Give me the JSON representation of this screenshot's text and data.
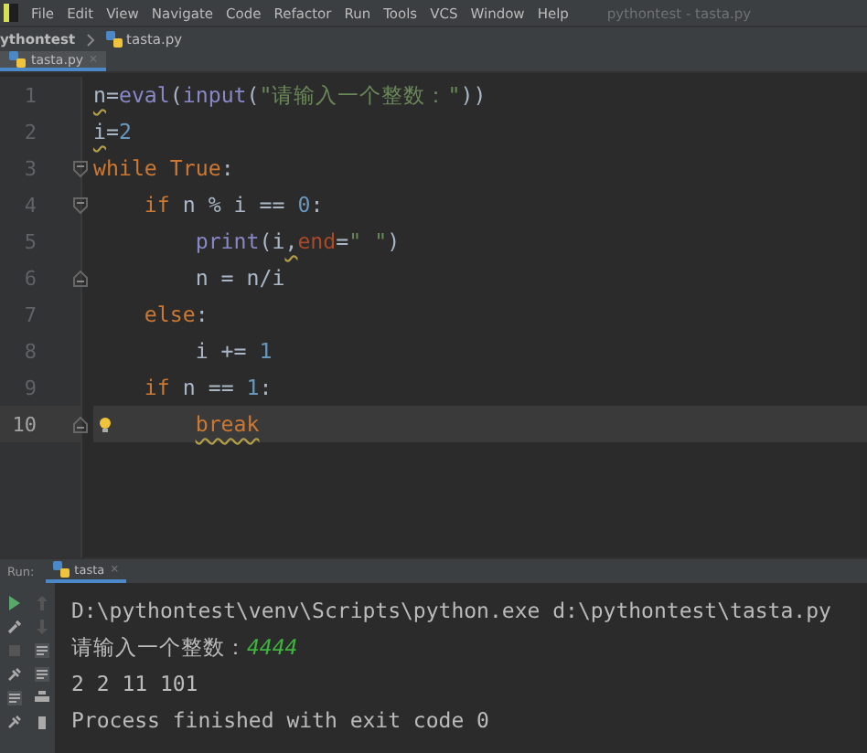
{
  "menu": [
    "File",
    "Edit",
    "View",
    "Navigate",
    "Code",
    "Refactor",
    "Run",
    "Tools",
    "VCS",
    "Window",
    "Help"
  ],
  "window": {
    "title": "pythontest - tasta.py"
  },
  "breadcrumb": {
    "project": "ythontest",
    "file": "tasta.py"
  },
  "tabs": [
    {
      "label": "tasta.py",
      "close": "×",
      "selected": true
    }
  ],
  "code_lines": [
    {
      "number": "1",
      "current": false,
      "tokens": [
        {
          "kind": "name",
          "text": "n",
          "warning": true
        },
        {
          "kind": "plain",
          "text": "="
        },
        {
          "kind": "builtin",
          "text": "eval"
        },
        {
          "kind": "plain",
          "text": "("
        },
        {
          "kind": "builtin",
          "text": "input"
        },
        {
          "kind": "plain",
          "text": "("
        },
        {
          "kind": "string",
          "text": "\"请输入一个整数：\""
        },
        {
          "kind": "plain",
          "text": "))"
        }
      ]
    },
    {
      "number": "2",
      "current": false,
      "tokens": [
        {
          "kind": "name",
          "text": "i",
          "warning": true
        },
        {
          "kind": "plain",
          "text": "="
        },
        {
          "kind": "number",
          "text": "2"
        }
      ]
    },
    {
      "number": "3",
      "current": false,
      "fold_marker": {
        "kind": "start"
      },
      "tokens": [
        {
          "kind": "keyword",
          "text": "while True"
        },
        {
          "kind": "plain",
          "text": ":"
        }
      ]
    },
    {
      "number": "4",
      "current": false,
      "fold_marker": {
        "kind": "start"
      },
      "tokens": [
        {
          "kind": "keyword",
          "text": "    if "
        },
        {
          "kind": "plain",
          "text": "n % i == "
        },
        {
          "kind": "number",
          "text": "0"
        },
        {
          "kind": "plain",
          "text": ":"
        }
      ]
    },
    {
      "number": "5",
      "current": false,
      "tokens": [
        {
          "kind": "builtin",
          "text": "        print"
        },
        {
          "kind": "plain",
          "text": "(i"
        },
        {
          "kind": "plain",
          "text": ",",
          "warning": true
        },
        {
          "kind": "param",
          "text": "end"
        },
        {
          "kind": "plain",
          "text": "="
        },
        {
          "kind": "string",
          "text": "\" \""
        },
        {
          "kind": "plain",
          "text": ")"
        }
      ]
    },
    {
      "number": "6",
      "current": false,
      "fold_marker": {
        "kind": "end"
      },
      "tokens": [
        {
          "kind": "plain",
          "text": "        n = n/i"
        }
      ]
    },
    {
      "number": "7",
      "current": false,
      "tokens": [
        {
          "kind": "keyword",
          "text": "    else"
        },
        {
          "kind": "plain",
          "text": ":"
        }
      ]
    },
    {
      "number": "8",
      "current": false,
      "tokens": [
        {
          "kind": "plain",
          "text": "        i += "
        },
        {
          "kind": "number",
          "text": "1"
        }
      ]
    },
    {
      "number": "9",
      "current": false,
      "tokens": [
        {
          "kind": "keyword",
          "text": "    if "
        },
        {
          "kind": "plain",
          "text": "n == "
        },
        {
          "kind": "number",
          "text": "1"
        },
        {
          "kind": "plain",
          "text": ":"
        }
      ]
    },
    {
      "number": "10",
      "current": true,
      "fold_marker": {
        "kind": "end"
      },
      "bulb": true,
      "tokens": [
        {
          "kind": "keyword",
          "text": "        break",
          "warning": true
        }
      ]
    }
  ],
  "run_panel": {
    "label": "Run:",
    "tabs": [
      {
        "label": "tasta",
        "close": "×",
        "selected": true
      }
    ]
  },
  "console_lines": [
    [
      {
        "kind": "output",
        "text": "D:\\pythontest\\venv\\Scripts\\python.exe d:\\pythontest\\tasta.py"
      }
    ],
    [
      {
        "kind": "output",
        "text": "请输入一个整数："
      },
      {
        "kind": "input",
        "text": "4444"
      }
    ],
    [
      {
        "kind": "output",
        "text": "2 2 11 101"
      }
    ],
    [
      {
        "kind": "output",
        "text": "Process finished with exit code 0"
      }
    ]
  ]
}
